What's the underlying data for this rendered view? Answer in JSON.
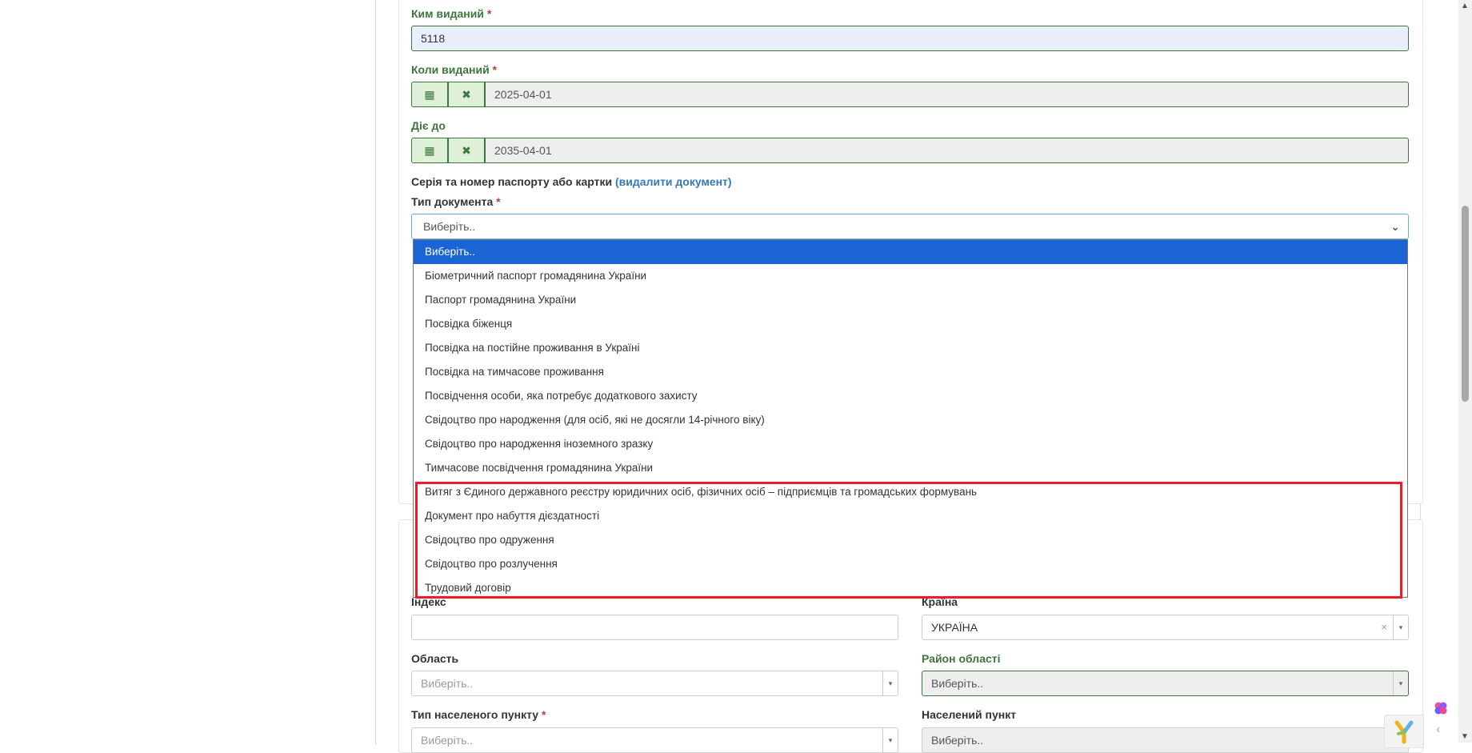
{
  "form": {
    "issued_by": {
      "label": "Ким виданий",
      "required": "*",
      "value": "5118"
    },
    "issued_date": {
      "label": "Коли виданий",
      "required": "*",
      "value": "2025-04-01"
    },
    "valid_until": {
      "label": "Діє до",
      "value": "2035-04-01"
    },
    "document_section": {
      "title": "Серія та номер паспорту або картки",
      "delete_link": "(видалити документ)"
    },
    "document_type": {
      "label": "Тип документа",
      "required": "*",
      "selected": "Виберіть..",
      "options": [
        "Виберіть..",
        "Біометричний паспорт громадянина України",
        "Паспорт громадянина України",
        "Посвідка біженця",
        "Посвідка на постійне проживання в Україні",
        "Посвідка на тимчасове проживання",
        "Посвідчення особи, яка потребує додаткового захисту",
        "Свідоцтво про народження (для осіб, які не досягли 14-річного віку)",
        "Свідоцтво про народження іноземного зразку",
        "Тимчасове посвідчення громадянина України",
        "Витяг з Єдиного державного реєстру юридичних осіб, фізичних осіб – підприємців та громадських формувань",
        "Документ про набуття дієздатності",
        "Свідоцтво про одруження",
        "Свідоцтво про розлучення",
        "Трудовий договір"
      ]
    },
    "address": {
      "index": {
        "label": "Індекс",
        "value": ""
      },
      "country": {
        "label": "Країна",
        "value": "УКРАЇНА",
        "clear": "×"
      },
      "region": {
        "label": "Область",
        "placeholder": "Виберіть.."
      },
      "district": {
        "label": "Район області",
        "placeholder": "Виберіть.."
      },
      "settlement_type": {
        "label": "Тип населеного пункту",
        "required": "*",
        "placeholder": "Виберіть.."
      },
      "settlement": {
        "label": "Населений пункт",
        "placeholder": "Виберіть.."
      }
    }
  },
  "icons": {
    "calendar": "▦",
    "remove": "✖",
    "chevron": "⌄",
    "arrow": "▾"
  },
  "colors": {
    "success_green": "#3c763d",
    "selected_option": "#1a64d4",
    "highlight_red": "#ee1c25",
    "link_blue": "#337ab7"
  }
}
